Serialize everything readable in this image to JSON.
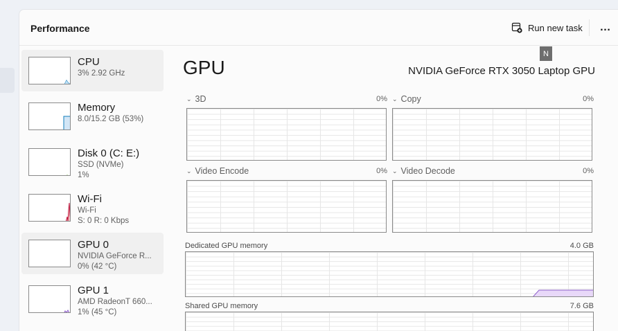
{
  "header": {
    "title": "Performance",
    "run_task_label": "Run new task",
    "more_label": "…"
  },
  "badge": "N",
  "sidebar": {
    "items": [
      {
        "name": "CPU",
        "line1": "3% 2.92 GHz",
        "line2": ""
      },
      {
        "name": "Memory",
        "line1": "8.0/15.2 GB (53%)",
        "line2": ""
      },
      {
        "name": "Disk 0 (C: E:)",
        "line1": "SSD (NVMe)",
        "line2": "1%"
      },
      {
        "name": "Wi-Fi",
        "line1": "Wi-Fi",
        "line2": "S: 0 R: 0 Kbps"
      },
      {
        "name": "GPU 0",
        "line1": "NVIDIA GeForce R...",
        "line2": "0% (42 °C)"
      },
      {
        "name": "GPU 1",
        "line1": "AMD RadeonT 660...",
        "line2": "1% (45 °C)"
      }
    ]
  },
  "main": {
    "title": "GPU",
    "model": "NVIDIA GeForce RTX 3050 Laptop GPU",
    "engines": [
      {
        "label": "3D",
        "percent": "0%"
      },
      {
        "label": "Copy",
        "percent": "0%"
      },
      {
        "label": "Video Encode",
        "percent": "0%"
      },
      {
        "label": "Video Decode",
        "percent": "0%"
      }
    ],
    "dedicated": {
      "label": "Dedicated GPU memory",
      "value": "4.0 GB"
    },
    "shared": {
      "label": "Shared GPU memory",
      "value": "7.6 GB"
    }
  },
  "colors": {
    "cpu": "#117dbb",
    "memory": "#8b12ae",
    "disk": "#4da60c",
    "wifi": "#a74f01",
    "gpu": "#8e5fca",
    "memory_fill": "#e8d8f8"
  }
}
